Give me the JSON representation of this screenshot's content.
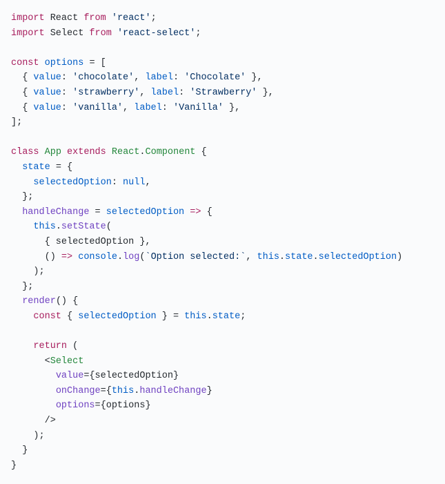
{
  "tokens": [
    [
      {
        "c": "kw",
        "t": "import"
      },
      {
        "c": "plain",
        "t": " React "
      },
      {
        "c": "kw",
        "t": "from"
      },
      {
        "c": "plain",
        "t": " "
      },
      {
        "c": "str",
        "t": "'react'"
      },
      {
        "c": "plain",
        "t": ";"
      }
    ],
    [
      {
        "c": "kw",
        "t": "import"
      },
      {
        "c": "plain",
        "t": " Select "
      },
      {
        "c": "kw",
        "t": "from"
      },
      {
        "c": "plain",
        "t": " "
      },
      {
        "c": "str",
        "t": "'react-select'"
      },
      {
        "c": "plain",
        "t": ";"
      }
    ],
    [],
    [
      {
        "c": "kw",
        "t": "const"
      },
      {
        "c": "plain",
        "t": " "
      },
      {
        "c": "const",
        "t": "options"
      },
      {
        "c": "plain",
        "t": " = ["
      }
    ],
    [
      {
        "c": "plain",
        "t": "  { "
      },
      {
        "c": "prop",
        "t": "value"
      },
      {
        "c": "plain",
        "t": ": "
      },
      {
        "c": "str",
        "t": "'chocolate'"
      },
      {
        "c": "plain",
        "t": ", "
      },
      {
        "c": "prop",
        "t": "label"
      },
      {
        "c": "plain",
        "t": ": "
      },
      {
        "c": "str",
        "t": "'Chocolate'"
      },
      {
        "c": "plain",
        "t": " },"
      }
    ],
    [
      {
        "c": "plain",
        "t": "  { "
      },
      {
        "c": "prop",
        "t": "value"
      },
      {
        "c": "plain",
        "t": ": "
      },
      {
        "c": "str",
        "t": "'strawberry'"
      },
      {
        "c": "plain",
        "t": ", "
      },
      {
        "c": "prop",
        "t": "label"
      },
      {
        "c": "plain",
        "t": ": "
      },
      {
        "c": "str",
        "t": "'Strawberry'"
      },
      {
        "c": "plain",
        "t": " },"
      }
    ],
    [
      {
        "c": "plain",
        "t": "  { "
      },
      {
        "c": "prop",
        "t": "value"
      },
      {
        "c": "plain",
        "t": ": "
      },
      {
        "c": "str",
        "t": "'vanilla'"
      },
      {
        "c": "plain",
        "t": ", "
      },
      {
        "c": "prop",
        "t": "label"
      },
      {
        "c": "plain",
        "t": ": "
      },
      {
        "c": "str",
        "t": "'Vanilla'"
      },
      {
        "c": "plain",
        "t": " },"
      }
    ],
    [
      {
        "c": "plain",
        "t": "];"
      }
    ],
    [],
    [
      {
        "c": "kw",
        "t": "class"
      },
      {
        "c": "plain",
        "t": " "
      },
      {
        "c": "cls",
        "t": "App"
      },
      {
        "c": "plain",
        "t": " "
      },
      {
        "c": "kw",
        "t": "extends"
      },
      {
        "c": "plain",
        "t": " "
      },
      {
        "c": "cls",
        "t": "React"
      },
      {
        "c": "plain",
        "t": "."
      },
      {
        "c": "cls",
        "t": "Component"
      },
      {
        "c": "plain",
        "t": " {"
      }
    ],
    [
      {
        "c": "plain",
        "t": "  "
      },
      {
        "c": "prop",
        "t": "state"
      },
      {
        "c": "plain",
        "t": " = {"
      }
    ],
    [
      {
        "c": "plain",
        "t": "    "
      },
      {
        "c": "prop",
        "t": "selectedOption"
      },
      {
        "c": "plain",
        "t": ": "
      },
      {
        "c": "const",
        "t": "null"
      },
      {
        "c": "plain",
        "t": ","
      }
    ],
    [
      {
        "c": "plain",
        "t": "  };"
      }
    ],
    [
      {
        "c": "plain",
        "t": "  "
      },
      {
        "c": "fn",
        "t": "handleChange"
      },
      {
        "c": "plain",
        "t": " = "
      },
      {
        "c": "prop",
        "t": "selectedOption"
      },
      {
        "c": "plain",
        "t": " "
      },
      {
        "c": "kw",
        "t": "=>"
      },
      {
        "c": "plain",
        "t": " {"
      }
    ],
    [
      {
        "c": "plain",
        "t": "    "
      },
      {
        "c": "this",
        "t": "this"
      },
      {
        "c": "plain",
        "t": "."
      },
      {
        "c": "fn",
        "t": "setState"
      },
      {
        "c": "plain",
        "t": "("
      }
    ],
    [
      {
        "c": "plain",
        "t": "      { selectedOption },"
      }
    ],
    [
      {
        "c": "plain",
        "t": "      () "
      },
      {
        "c": "kw",
        "t": "=>"
      },
      {
        "c": "plain",
        "t": " "
      },
      {
        "c": "const",
        "t": "console"
      },
      {
        "c": "plain",
        "t": "."
      },
      {
        "c": "fn",
        "t": "log"
      },
      {
        "c": "plain",
        "t": "("
      },
      {
        "c": "str",
        "t": "`Option selected:`"
      },
      {
        "c": "plain",
        "t": ", "
      },
      {
        "c": "this",
        "t": "this"
      },
      {
        "c": "plain",
        "t": "."
      },
      {
        "c": "prop",
        "t": "state"
      },
      {
        "c": "plain",
        "t": "."
      },
      {
        "c": "prop",
        "t": "selectedOption"
      },
      {
        "c": "plain",
        "t": ")"
      }
    ],
    [
      {
        "c": "plain",
        "t": "    );"
      }
    ],
    [
      {
        "c": "plain",
        "t": "  };"
      }
    ],
    [
      {
        "c": "plain",
        "t": "  "
      },
      {
        "c": "fn",
        "t": "render"
      },
      {
        "c": "plain",
        "t": "() {"
      }
    ],
    [
      {
        "c": "plain",
        "t": "    "
      },
      {
        "c": "kw",
        "t": "const"
      },
      {
        "c": "plain",
        "t": " { "
      },
      {
        "c": "const",
        "t": "selectedOption"
      },
      {
        "c": "plain",
        "t": " } = "
      },
      {
        "c": "this",
        "t": "this"
      },
      {
        "c": "plain",
        "t": "."
      },
      {
        "c": "prop",
        "t": "state"
      },
      {
        "c": "plain",
        "t": ";"
      }
    ],
    [],
    [
      {
        "c": "plain",
        "t": "    "
      },
      {
        "c": "kw",
        "t": "return"
      },
      {
        "c": "plain",
        "t": " ("
      }
    ],
    [
      {
        "c": "plain",
        "t": "      <"
      },
      {
        "c": "cls",
        "t": "Select"
      }
    ],
    [
      {
        "c": "plain",
        "t": "        "
      },
      {
        "c": "attr",
        "t": "value"
      },
      {
        "c": "plain",
        "t": "={selectedOption}"
      }
    ],
    [
      {
        "c": "plain",
        "t": "        "
      },
      {
        "c": "attr",
        "t": "onChange"
      },
      {
        "c": "plain",
        "t": "={"
      },
      {
        "c": "this",
        "t": "this"
      },
      {
        "c": "plain",
        "t": "."
      },
      {
        "c": "fn",
        "t": "handleChange"
      },
      {
        "c": "plain",
        "t": "}"
      }
    ],
    [
      {
        "c": "plain",
        "t": "        "
      },
      {
        "c": "attr",
        "t": "options"
      },
      {
        "c": "plain",
        "t": "={options}"
      }
    ],
    [
      {
        "c": "plain",
        "t": "      />"
      }
    ],
    [
      {
        "c": "plain",
        "t": "    );"
      }
    ],
    [
      {
        "c": "plain",
        "t": "  }"
      }
    ],
    [
      {
        "c": "plain",
        "t": "}"
      }
    ]
  ]
}
